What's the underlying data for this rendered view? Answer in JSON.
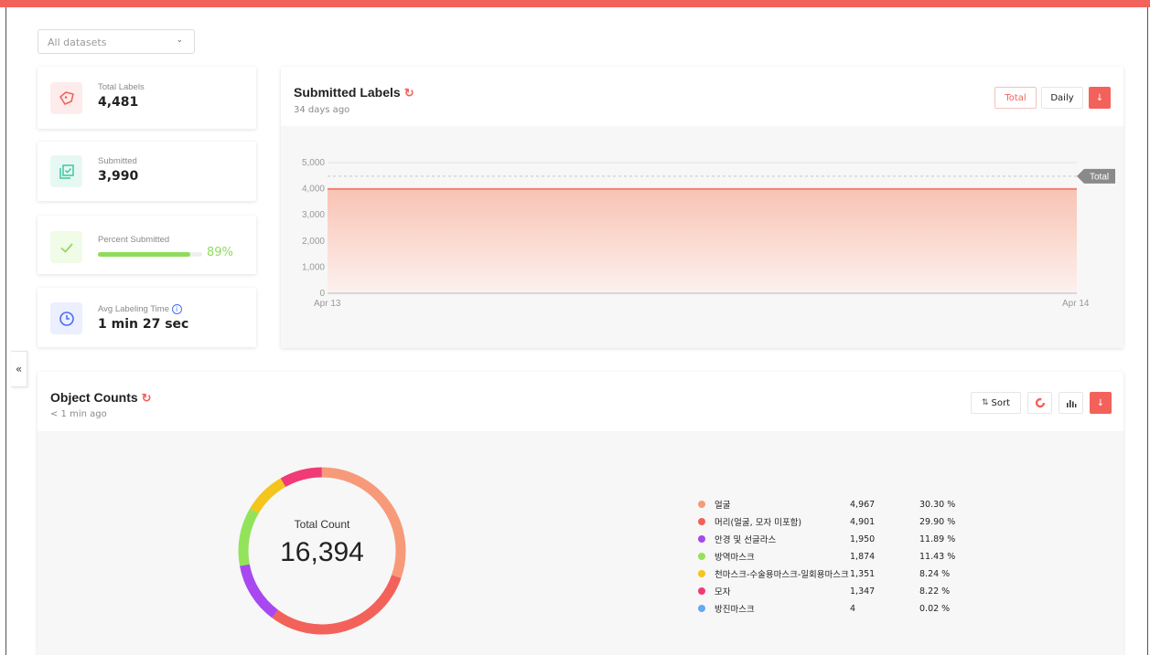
{
  "dataset_select": {
    "value": "All datasets"
  },
  "collapse_label": "«",
  "stats": [
    {
      "label": "Total Labels",
      "value": "4,481",
      "icon": "tag-icon",
      "color": "#f3625a",
      "bg": "#fdeceb"
    },
    {
      "label": "Submitted",
      "value": "3,990",
      "icon": "checklist-icon",
      "color": "#3cc8a4",
      "bg": "#e7f8f3"
    },
    {
      "label": "Percent Submitted",
      "value": "89%",
      "progress": 0.89,
      "icon": "check-icon",
      "color": "#8fdc5a",
      "bg": "#f0fbe8"
    },
    {
      "label": "Avg Labeling Time",
      "value": "1 min 27 sec",
      "icon": "clock-icon",
      "info_icon": "info-icon",
      "color": "#4a6cf7",
      "bg": "#ebefff"
    }
  ],
  "submitted_labels": {
    "title": "Submitted Labels",
    "subtitle": "34 days ago",
    "buttons": {
      "total": "Total",
      "daily": "Daily",
      "download": "↓"
    },
    "total_marker_label": "Total"
  },
  "chart_data": {
    "type": "area",
    "x": [
      "Apr 13",
      "Apr 14"
    ],
    "series": [
      {
        "values": [
          3990,
          3990
        ]
      }
    ],
    "reference_line": {
      "label": "Total",
      "value": 4481
    },
    "yticks": [
      "5,000",
      "4,000",
      "3,000",
      "2,000",
      "1,000",
      "0"
    ],
    "ylim": [
      0,
      5000
    ],
    "grid": true,
    "colors": {
      "line": "#f3806f",
      "fill_top": "#f8c3b4",
      "fill_bottom": "#fdf1ee"
    }
  },
  "object_counts": {
    "title": "Object Counts",
    "subtitle": "< 1 min ago",
    "buttons": {
      "sort": "Sort",
      "sort_icon": "sort-icon",
      "donut_icon": "donut-chart-icon",
      "bar_icon": "bar-chart-icon",
      "download": "↓"
    },
    "donut": {
      "center_label": "Total Count",
      "center_value": "16,394",
      "segments": [
        {
          "name": "얼굴",
          "count": "4,967",
          "pct": "30.30 %",
          "value": 4967,
          "color": "#f79a79"
        },
        {
          "name": "머리(얼굴, 모자 미포함)",
          "count": "4,901",
          "pct": "29.90 %",
          "value": 4901,
          "color": "#f3625a"
        },
        {
          "name": "안경 및 선글라스",
          "count": "1,950",
          "pct": "11.89 %",
          "value": 1950,
          "color": "#a748f0"
        },
        {
          "name": "방역마스크",
          "count": "1,874",
          "pct": "11.43 %",
          "value": 1874,
          "color": "#92e35a"
        },
        {
          "name": "천마스크-수술용마스크-일회용마스크",
          "count": "1,351",
          "pct": "8.24 %",
          "value": 1351,
          "color": "#f4c51a"
        },
        {
          "name": "모자",
          "count": "1,347",
          "pct": "8.22 %",
          "value": 1347,
          "color": "#f03b76"
        },
        {
          "name": "방진마스크",
          "count": "4",
          "pct": "0.02 %",
          "value": 4,
          "color": "#64aaf3"
        }
      ]
    }
  }
}
